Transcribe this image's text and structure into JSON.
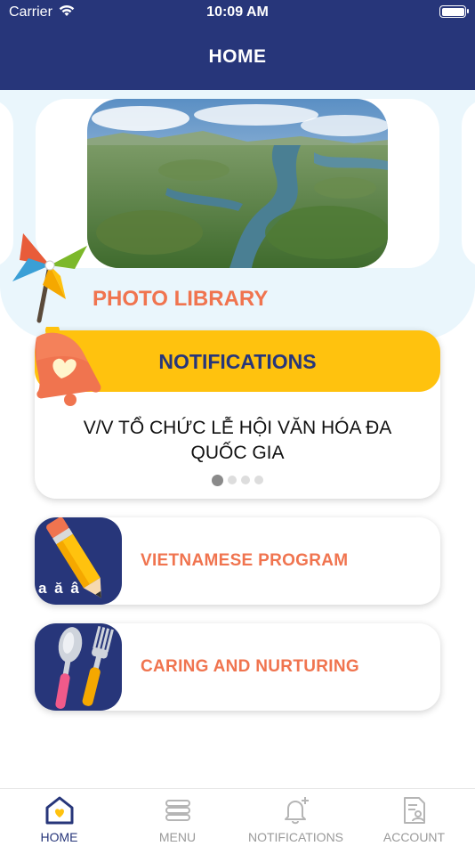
{
  "status_bar": {
    "carrier": "Carrier",
    "time": "10:09 AM"
  },
  "header": {
    "title": "HOME"
  },
  "photo_library": {
    "label": "PHOTO LIBRARY"
  },
  "notifications_card": {
    "title": "NOTIFICATIONS",
    "message": "V/V TỔ CHỨC LỄ HỘI VĂN HÓA ĐA QUỐC GIA",
    "page_count": 4,
    "active_page": 1
  },
  "menu_cards": [
    {
      "label": "VIETNAMESE PROGRAM",
      "icon": "pencil-icon",
      "icon_text": "a ă â"
    },
    {
      "label": "CARING AND NURTURING",
      "icon": "spoon-fork-icon"
    }
  ],
  "tab_bar": {
    "tabs": [
      {
        "label": "HOME",
        "icon": "home-heart-icon",
        "active": true
      },
      {
        "label": "MENU",
        "icon": "menu-list-icon",
        "active": false
      },
      {
        "label": "NOTIFICATIONS",
        "icon": "bell-plus-icon",
        "active": false
      },
      {
        "label": "ACCOUNT",
        "icon": "account-document-icon",
        "active": false
      }
    ]
  },
  "colors": {
    "header_bg": "#27367a",
    "accent_orange": "#f0744f",
    "notification_yellow": "#ffc20e",
    "band_bg": "#eaf6fc"
  }
}
